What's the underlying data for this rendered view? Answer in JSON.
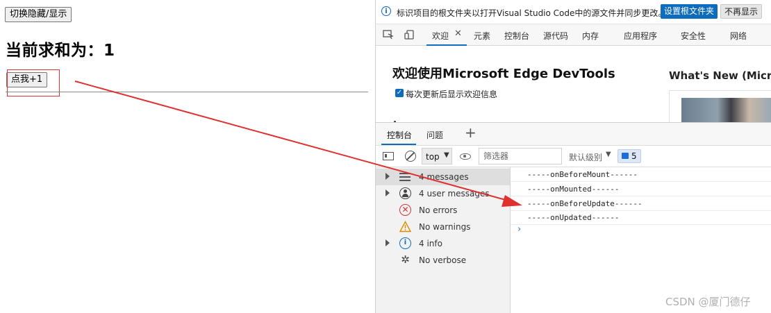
{
  "left_page": {
    "toggle_button": "切换隐藏/显示",
    "sum_heading": "当前求和为：1",
    "plus_button": "点我+1"
  },
  "infobar": {
    "message": "标识项目的根文件夹以打开Visual Studio Code中的源文件并同步更改。",
    "set_root_button": "设置根文件夹",
    "dont_show_button": "不再显示"
  },
  "main_tabs": [
    {
      "label": "欢迎",
      "active": true
    },
    {
      "label": "元素"
    },
    {
      "label": "控制台"
    },
    {
      "label": "源代码"
    },
    {
      "label": "内存"
    },
    {
      "label": "应用程序"
    },
    {
      "label": "安全性"
    },
    {
      "label": "网络"
    }
  ],
  "welcome": {
    "title": "欢迎使用Microsoft Edge DevTools",
    "checkbox_label": "每次更新后显示欢迎信息",
    "whats_new": "What's New (Microsc"
  },
  "drawer_tabs": [
    {
      "label": "控制台",
      "active": true
    },
    {
      "label": "问题"
    }
  ],
  "console_toolbar": {
    "context": "top",
    "filter_placeholder": "筛选器",
    "levels": "默认级别",
    "issues_count": "5"
  },
  "sidebar": {
    "items": [
      {
        "label": "4 messages",
        "icon": "list-icon",
        "expandable": true
      },
      {
        "label": "4 user messages",
        "icon": "user-icon",
        "expandable": true
      },
      {
        "label": "No errors",
        "icon": "error-icon",
        "expandable": false
      },
      {
        "label": "No warnings",
        "icon": "warning-icon",
        "expandable": false
      },
      {
        "label": "4 info",
        "icon": "info-icon",
        "expandable": true
      },
      {
        "label": "No verbose",
        "icon": "bug-icon",
        "expandable": false
      }
    ]
  },
  "console_logs": [
    "-----onBeforeMount------",
    "-----onMounted------",
    "-----onBeforeUpdate------",
    "-----onUpdated------"
  ],
  "watermark": "CSDN @厦门德仔",
  "colors": {
    "accent": "#0f6cbd",
    "annotation_red": "#e03030"
  }
}
